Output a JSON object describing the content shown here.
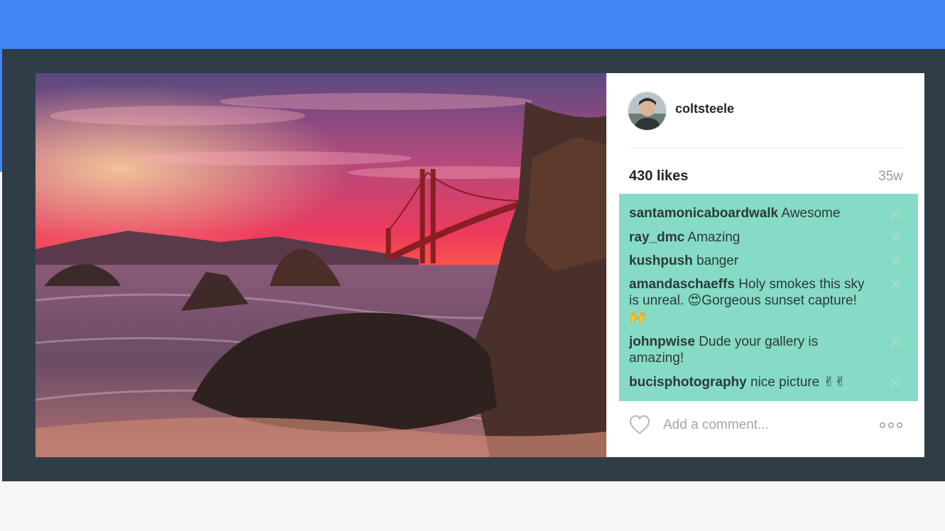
{
  "post": {
    "username": "coltsteele",
    "likes": "430 likes",
    "age": "35w",
    "image_subject": "golden-gate-bridge-sunset-photo"
  },
  "comments": [
    {
      "user": "santamonicaboardwalk",
      "text": "Awesome"
    },
    {
      "user": "ray_dmc",
      "text": "Amazing"
    },
    {
      "user": "kushpush",
      "text": "banger"
    },
    {
      "user": "amandaschaeffs",
      "text": "Holy smokes this sky is unreal. 😍Gorgeous sunset capture! 🙌"
    },
    {
      "user": "johnpwise",
      "text": "Dude your gallery is amazing!"
    },
    {
      "user": "bucisphotography",
      "text": "nice picture ✌✌"
    }
  ],
  "composer": {
    "placeholder": "Add a comment..."
  },
  "icons": {
    "like": "heart-icon",
    "more": "more-options-icon",
    "remove": "close-icon"
  },
  "colors": {
    "top_bar": "#4286f4",
    "frame": "#2f3d48",
    "comments_highlight": "#86dbc6"
  }
}
